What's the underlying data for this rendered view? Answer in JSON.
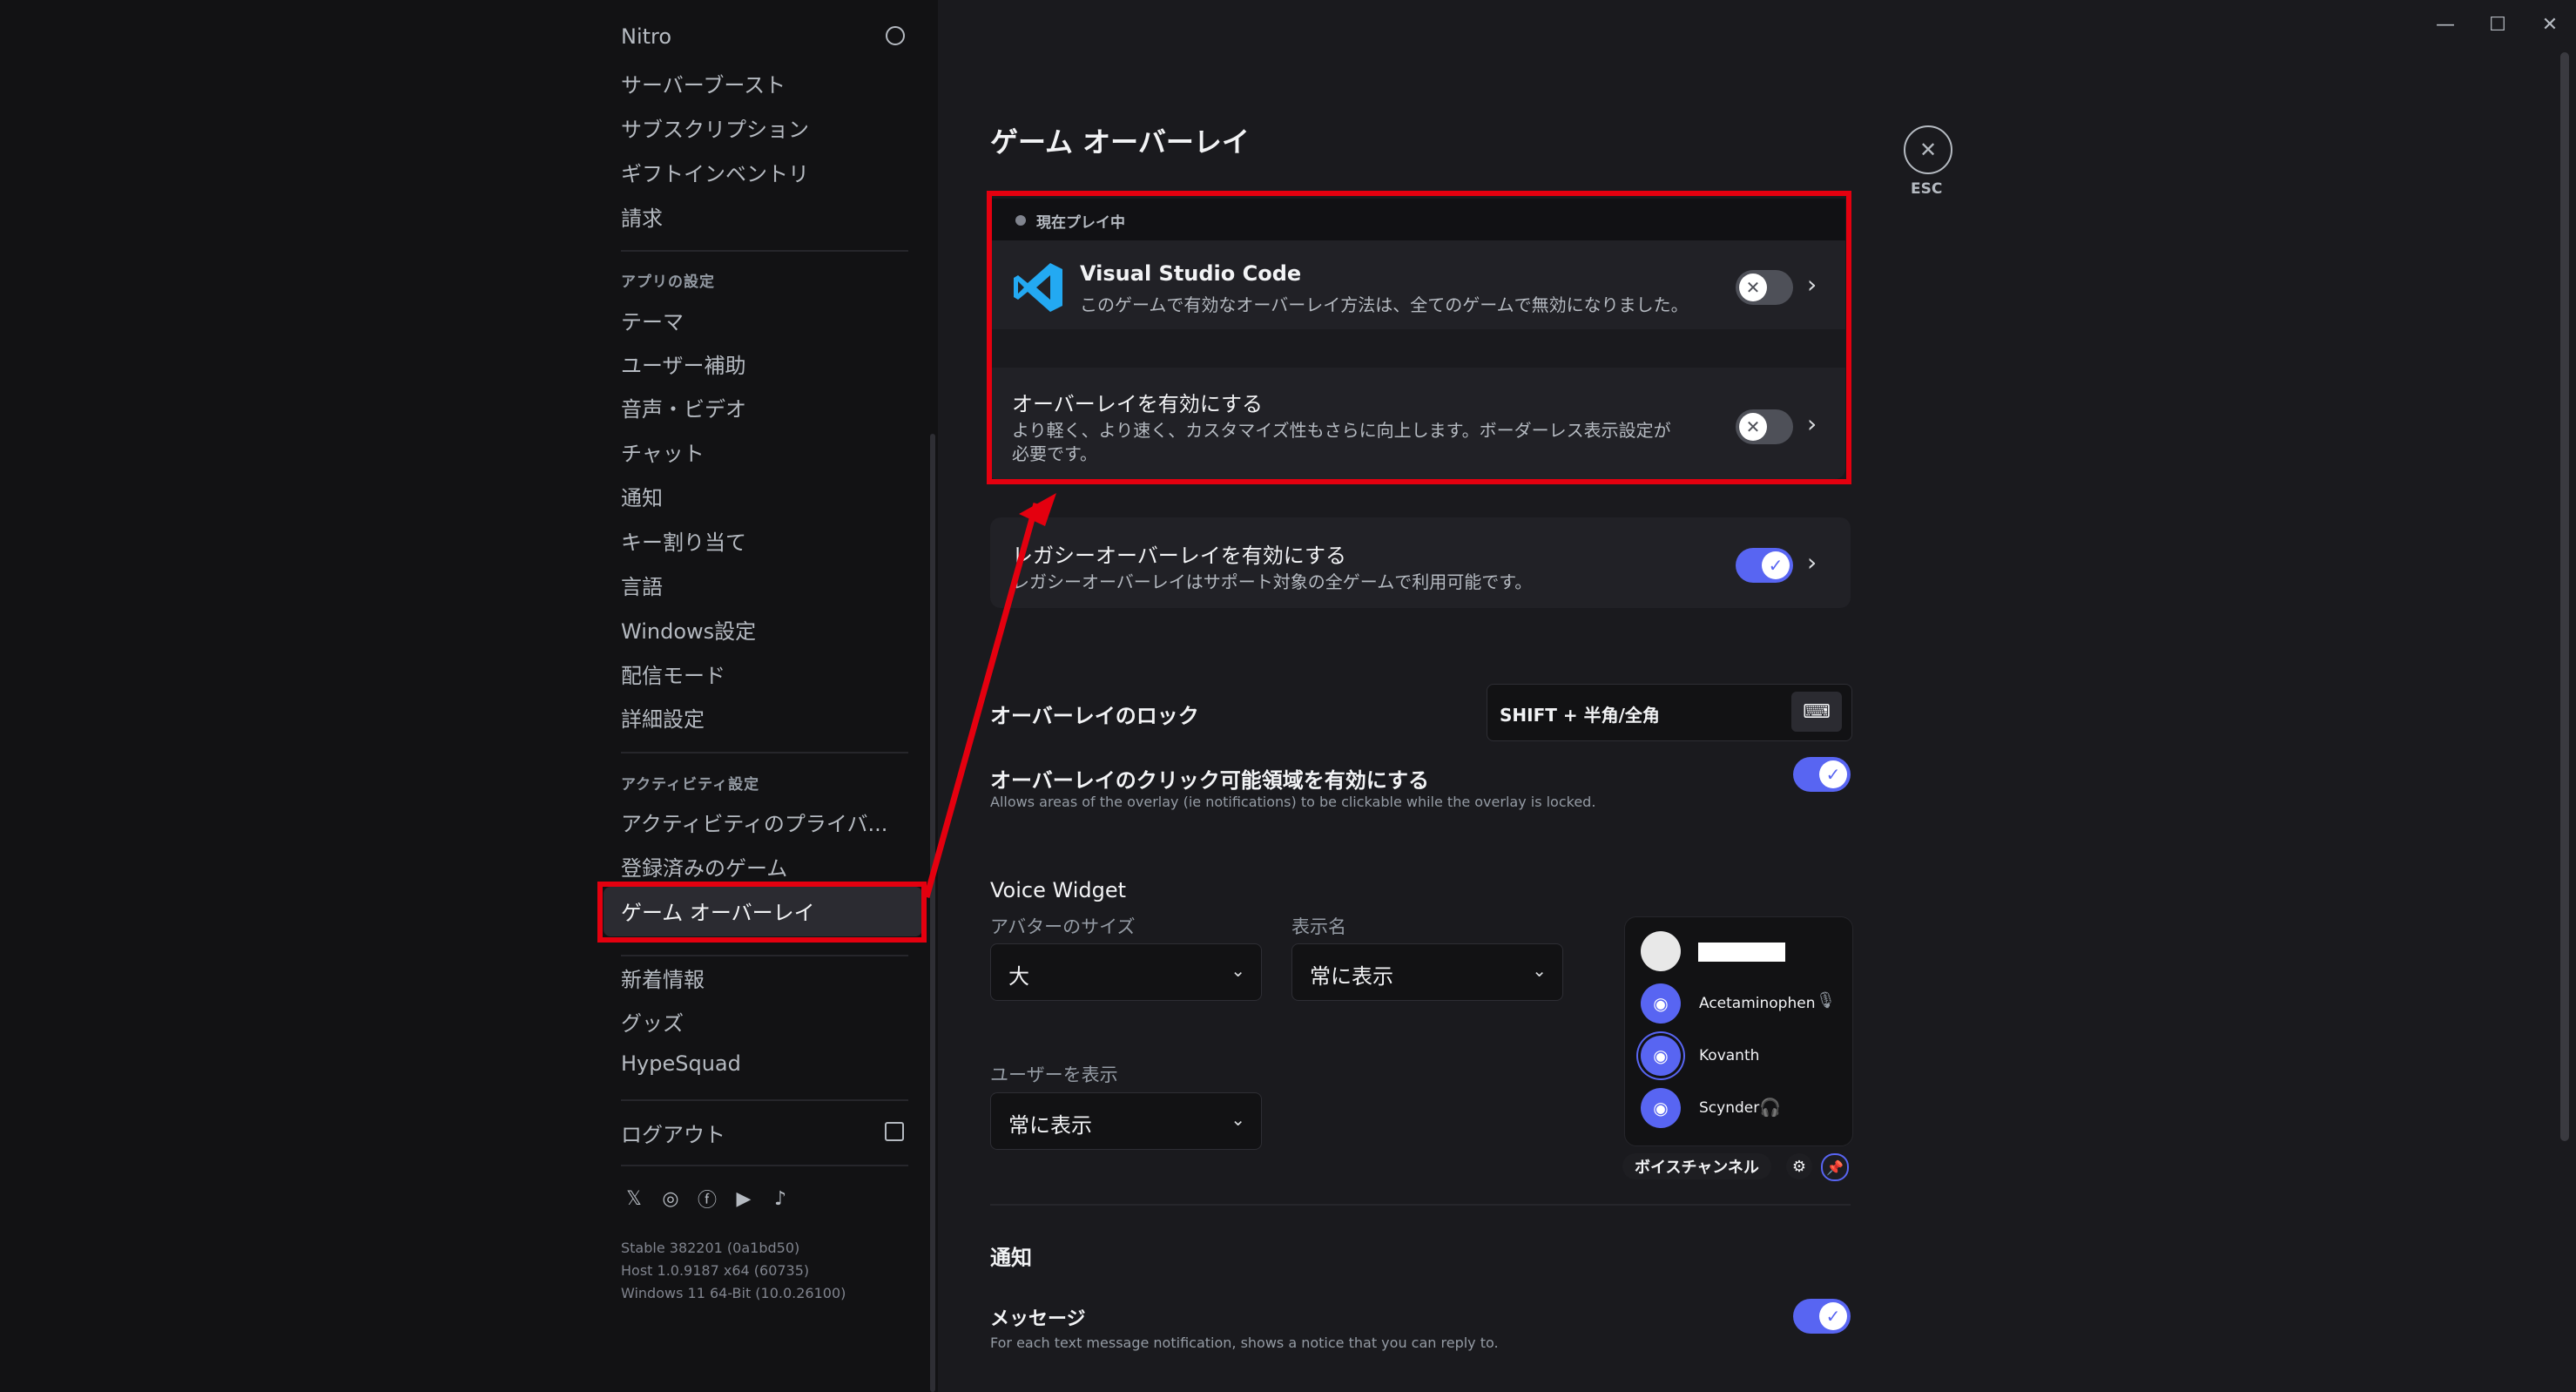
{
  "window": {
    "controls": [
      "—",
      "☐",
      "✕"
    ]
  },
  "sidebar": {
    "items_top": [
      "Nitro",
      "サーバーブースト",
      "サブスクリプション",
      "ギフトインベントリ",
      "請求"
    ],
    "app_settings_header": "アプリの設定",
    "app_settings": [
      "テーマ",
      "ユーザー補助",
      "音声・ビデオ",
      "チャット",
      "通知",
      "キー割り当て",
      "言語",
      "Windows設定",
      "配信モード",
      "詳細設定"
    ],
    "activity_header": "アクティビティ設定",
    "activity": [
      "アクティビティのプライバ...",
      "登録済みのゲーム",
      "ゲーム オーバーレイ"
    ],
    "misc": [
      "新着情報",
      "グッズ",
      "HypeSquad"
    ],
    "logout": "ログアウト",
    "version": [
      "Stable 382201 (0a1bd50)",
      "Host 1.0.9187 x64 (60735)",
      "Windows 11 64-Bit (10.0.26100)"
    ]
  },
  "main": {
    "title": "ゲーム オーバーレイ",
    "esc_label": "ESC",
    "now_playing": "現在プレイ中",
    "game": {
      "name": "Visual Studio Code",
      "desc": "このゲームで有効なオーバーレイ方法は、全てのゲームで無効になりました。"
    },
    "overlay_enable": {
      "title": "オーバーレイを有効にする",
      "desc_line1": "より軽く、より速く、カスタマイズ性もさらに向上します。ボーダーレス表示設定が",
      "desc_line2": "必要です。"
    },
    "legacy": {
      "title": "レガシーオーバーレイを有効にする",
      "desc": "レガシーオーバーレイはサポート対象の全ゲームで利用可能です。"
    },
    "lock": {
      "title": "オーバーレイのロック",
      "keybind": "SHIFT + 半角/全角"
    },
    "clickable": {
      "title": "オーバーレイのクリック可能領域を有効にする",
      "desc": "Allows areas of the overlay (ie notifications) to be clickable while the overlay is locked."
    },
    "voice_widget": {
      "title": "Voice Widget",
      "avatar_size_label": "アバターのサイズ",
      "avatar_size_value": "大",
      "display_name_label": "表示名",
      "display_name_value": "常に表示",
      "show_users_label": "ユーザーを表示",
      "show_users_value": "常に表示",
      "preview_users": [
        "Acetaminophen",
        "Kovanth",
        "Scynder"
      ],
      "channel_label": "ボイスチャンネル"
    },
    "notifications": {
      "title": "通知",
      "message_title": "メッセージ",
      "message_desc": "For each text message notification, shows a notice that you can reply to."
    }
  },
  "colors": {
    "accent": "#5865f2",
    "highlight": "#e4000f",
    "vscode": "#23a9f2"
  }
}
